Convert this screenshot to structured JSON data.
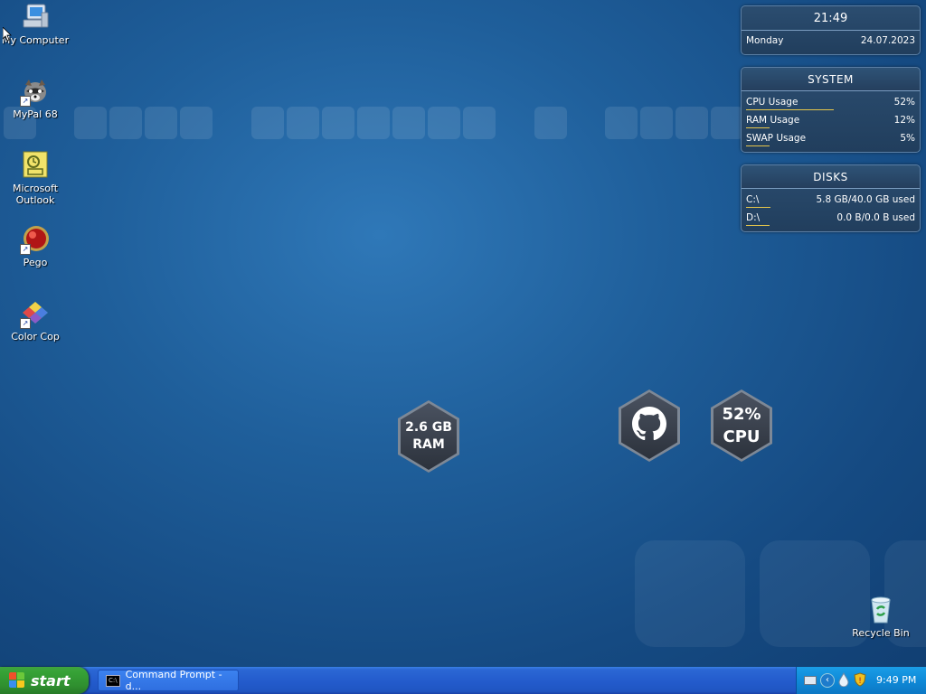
{
  "desktop_icons": [
    {
      "label": "My Computer"
    },
    {
      "label": "MyPal 68"
    },
    {
      "label": "Microsoft Outlook"
    },
    {
      "label": "Pego"
    },
    {
      "label": "Color Cop"
    },
    {
      "label": "Recycle Bin"
    }
  ],
  "clock_widget": {
    "time": "21:49",
    "day": "Monday",
    "date": "24.07.2023"
  },
  "system_widget": {
    "title": "SYSTEM",
    "rows": [
      {
        "label": "CPU Usage",
        "value": "52%",
        "fraction": 0.52
      },
      {
        "label": "RAM Usage",
        "value": "12%",
        "fraction": 0.12
      },
      {
        "label": "SWAP Usage",
        "value": "5%",
        "fraction": 0.05
      }
    ]
  },
  "disks_widget": {
    "title": "DISKS",
    "rows": [
      {
        "label": "C:\\",
        "value": "5.8 GB/40.0 GB used",
        "fraction": 0.145
      },
      {
        "label": "D:\\",
        "value": "0.0 B/0.0 B used",
        "fraction": 0.0
      }
    ]
  },
  "gadgets": {
    "ram": {
      "line1": "2.6 GB",
      "line2": "RAM"
    },
    "cpu": {
      "line1": "52%",
      "line2": "CPU"
    },
    "github": {
      "icon": "github-icon"
    }
  },
  "taskbar": {
    "start_label": "start",
    "task_button_label": "Command Prompt - d...",
    "clock": "9:49 PM"
  },
  "colors": {
    "usage_bar": "#e6c64b",
    "taskbar": "#245ccd",
    "start": "#36a236",
    "tray": "#0f8ad8"
  }
}
